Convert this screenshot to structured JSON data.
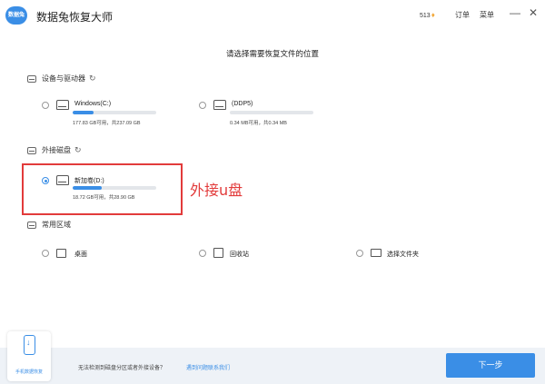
{
  "app": {
    "logo_text": "数据兔",
    "title": "数据兔恢复大师"
  },
  "header": {
    "credits": "513",
    "orders_label": "订单",
    "menu_label": "菜单",
    "minimize_label": "—",
    "close_label": "✕"
  },
  "headline": "请选择需要恢复文件的位置",
  "sections": {
    "devices": "设备与驱动器",
    "external": "外接磁盘",
    "common": "常用区域"
  },
  "drives": [
    {
      "name": "Windows(C:)",
      "capacity": "177.83 GB可用，共237.09 GB",
      "used_fraction": 0.25,
      "selected": false
    },
    {
      "name": "(DDP5)",
      "capacity": "0.34 MB可用，共0.34 MB",
      "used_fraction": 0.0,
      "selected": false
    }
  ],
  "external_drives": [
    {
      "name": "新加卷(D:)",
      "capacity": "18.72 GB可用，共28.90 GB",
      "used_fraction": 0.35,
      "selected": true
    }
  ],
  "annotation": "外接u盘",
  "locations": [
    {
      "label": "桌面",
      "icon": "monitor-icon"
    },
    {
      "label": "回收站",
      "icon": "recycle-bin-icon"
    },
    {
      "label": "选择文件夹",
      "icon": "folder-icon"
    }
  ],
  "footer": {
    "phone_label": "手机数据恢复",
    "hint": "无法检测到磁盘分区或者外接设备？",
    "link": "遇到问题联系我们",
    "next_label": "下一步"
  },
  "colors": {
    "accent": "#3a8ee6",
    "highlight": "#e23b3b",
    "footer_bg": "#eef2f7"
  }
}
